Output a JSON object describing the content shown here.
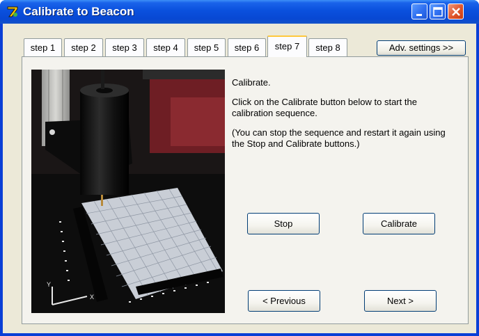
{
  "window": {
    "title": "Calibrate to Beacon"
  },
  "titlebar_buttons": [
    "minimize-icon",
    "maximize-icon",
    "close-icon"
  ],
  "tabs": [
    {
      "label": "step 1",
      "active": false
    },
    {
      "label": "step 2",
      "active": false
    },
    {
      "label": "step 3",
      "active": false
    },
    {
      "label": "step 4",
      "active": false
    },
    {
      "label": "step 5",
      "active": false
    },
    {
      "label": "step 6",
      "active": false
    },
    {
      "label": "step 7",
      "active": true
    },
    {
      "label": "step 8",
      "active": false
    }
  ],
  "adv_settings_label": "Adv. settings >>",
  "content": {
    "heading": "Calibrate.",
    "instruction": "Click on the Calibrate button below to start the calibration sequence.",
    "note": "(You can stop the sequence and restart it again using the Stop and Calibrate buttons.)"
  },
  "buttons": {
    "stop": "Stop",
    "calibrate": "Calibrate",
    "previous": "< Previous",
    "next": "Next >"
  },
  "colors": {
    "titlebar": "#0a50dd",
    "dialog_face": "#ece9d8",
    "active_tab_accent": "#ffc83c",
    "close_button": "#e0552b"
  }
}
